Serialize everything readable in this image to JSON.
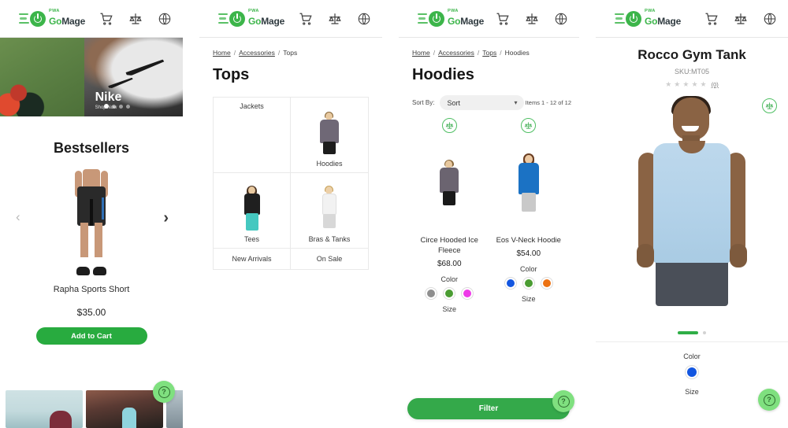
{
  "header": {
    "logo_pwa": "PWA",
    "logo_go": "Go",
    "logo_mage": "Mage",
    "icons": [
      "cart-icon",
      "compare-icon",
      "globe-icon"
    ]
  },
  "panel_home": {
    "banner": {
      "title": "Nike",
      "subtitle": "Shop Now",
      "dots": 4,
      "active_dot": 0
    },
    "section_title": "Bestsellers",
    "product": {
      "name": "Rapha Sports Short",
      "price": "$35.00",
      "add_to_cart": "Add to Cart"
    },
    "prev_arrow": "‹",
    "next_arrow": "›",
    "help_label": "?"
  },
  "panel_tops": {
    "breadcrumb": [
      {
        "label": "Home",
        "link": true
      },
      {
        "label": "Accessories",
        "link": true
      },
      {
        "label": "Tops",
        "link": false
      }
    ],
    "title": "Tops",
    "categories": [
      {
        "label": "Jackets",
        "has_image": false,
        "label_position": "top"
      },
      {
        "label": "Hoodies",
        "has_image": true,
        "label_position": "bottom"
      },
      {
        "label": "Tees",
        "has_image": true,
        "label_position": "bottom"
      },
      {
        "label": "Bras & Tanks",
        "has_image": true,
        "label_position": "bottom"
      },
      {
        "label": "New Arrivals",
        "has_image": false,
        "label_position": "center"
      },
      {
        "label": "On Sale",
        "has_image": false,
        "label_position": "center"
      }
    ]
  },
  "panel_hoodies": {
    "breadcrumb": [
      {
        "label": "Home",
        "link": true
      },
      {
        "label": "Accessories",
        "link": true
      },
      {
        "label": "Tops",
        "link": true
      },
      {
        "label": "Hoodies",
        "link": false
      }
    ],
    "title": "Hoodies",
    "sort_label": "Sort By:",
    "sort_value": "Sort",
    "items_count": "Items 1 - 12 of 12",
    "products": [
      {
        "name": "Circe Hooded Ice Fleece",
        "price": "$68.00",
        "color_label": "Color",
        "size_label": "Size",
        "colors": [
          "#8e8e8e",
          "#4a9c32",
          "#ee3ae8"
        ]
      },
      {
        "name": "Eos V-Neck Hoodie",
        "price": "$54.00",
        "color_label": "Color",
        "size_label": "Size",
        "colors": [
          "#1356e0",
          "#4a9c32",
          "#ec7111"
        ]
      }
    ],
    "filter_label": "Filter",
    "help_label": "?"
  },
  "panel_product": {
    "title": "Rocco Gym Tank",
    "sku": "SKU:MT05",
    "stars": 5,
    "review_count": "(0)",
    "color_label": "Color",
    "color_value": "#1356e0",
    "size_label": "Size",
    "help_label": "?"
  },
  "colors": {
    "brand_green": "#3cb54a",
    "button_green": "#28ab3f",
    "filter_green": "#34a94a",
    "fab_green": "#7fe07f"
  }
}
